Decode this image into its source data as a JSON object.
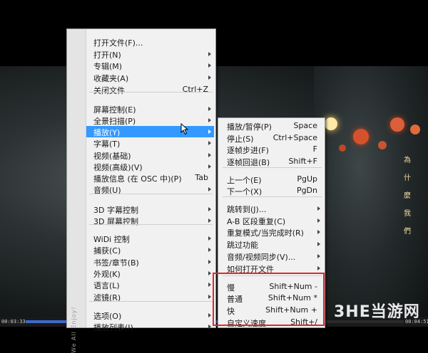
{
  "player": {
    "time_current": "00:03:33",
    "time_total": "00:04:51",
    "progress": 0.73,
    "lyric_chars": [
      "為",
      "什",
      "麼",
      "我",
      "們"
    ]
  },
  "watermark": {
    "text": "3HE当游网"
  },
  "context_menu": {
    "strip_text": "We All Enjoy!",
    "items": [
      {
        "label": "打开文件(F)...",
        "shortcut": "",
        "submenu": false
      },
      {
        "label": "打开(N)",
        "shortcut": "",
        "submenu": true
      },
      {
        "label": "专辑(M)",
        "shortcut": "",
        "submenu": true
      },
      {
        "label": "收藏夹(A)",
        "shortcut": "",
        "submenu": true
      },
      {
        "label": "关闭文件",
        "shortcut": "Ctrl+Z",
        "submenu": false
      },
      {
        "label": "屏幕控制(E)",
        "shortcut": "",
        "submenu": true
      },
      {
        "label": "全景扫描(P)",
        "shortcut": "",
        "submenu": true
      },
      {
        "label": "播放(Y)",
        "shortcut": "",
        "submenu": true,
        "highlighted": true
      },
      {
        "label": "字幕(T)",
        "shortcut": "",
        "submenu": true
      },
      {
        "label": "视频(基础)",
        "shortcut": "",
        "submenu": true
      },
      {
        "label": "视频(高级)(V)",
        "shortcut": "",
        "submenu": true
      },
      {
        "label": "播放信息 (在 OSC 中)(P)",
        "shortcut": "Tab",
        "submenu": false
      },
      {
        "label": "音频(U)",
        "shortcut": "",
        "submenu": true
      },
      {
        "label": "3D 字幕控制",
        "shortcut": "",
        "submenu": true
      },
      {
        "label": "3D 屏幕控制",
        "shortcut": "",
        "submenu": true
      },
      {
        "label": "WiDi 控制",
        "shortcut": "",
        "submenu": true
      },
      {
        "label": "捕获(C)",
        "shortcut": "",
        "submenu": true
      },
      {
        "label": "书签/章节(B)",
        "shortcut": "",
        "submenu": true
      },
      {
        "label": "外观(K)",
        "shortcut": "",
        "submenu": true
      },
      {
        "label": "语言(L)",
        "shortcut": "",
        "submenu": true
      },
      {
        "label": "滤镜(R)",
        "shortcut": "",
        "submenu": true
      },
      {
        "label": "选项(O)",
        "shortcut": "",
        "submenu": true
      },
      {
        "label": "播放列表(I)",
        "shortcut": "",
        "submenu": true
      }
    ]
  },
  "submenu": {
    "items": [
      {
        "label": "播放/暂停(P)",
        "shortcut": "Space",
        "submenu": false
      },
      {
        "label": "停止(S)",
        "shortcut": "Ctrl+Space",
        "submenu": false
      },
      {
        "label": "逐帧步进(F)",
        "shortcut": "F",
        "submenu": false
      },
      {
        "label": "逐帧回退(B)",
        "shortcut": "Shift+F",
        "submenu": false
      },
      {
        "label": "上一个(E)",
        "shortcut": "PgUp",
        "submenu": false
      },
      {
        "label": "下一个(X)",
        "shortcut": "PgDn",
        "submenu": false
      },
      {
        "label": "跳转到(J)...",
        "shortcut": "",
        "submenu": true
      },
      {
        "label": "A-B 区段重复(C)",
        "shortcut": "",
        "submenu": true
      },
      {
        "label": "重复模式/当完成时(R)",
        "shortcut": "",
        "submenu": true
      },
      {
        "label": "跳过功能",
        "shortcut": "",
        "submenu": true
      },
      {
        "label": "音频/视频同步(V)...",
        "shortcut": "",
        "submenu": true
      },
      {
        "label": "如何打开文件",
        "shortcut": "",
        "submenu": true
      },
      {
        "label": "慢",
        "shortcut": "Shift+Num -",
        "submenu": false
      },
      {
        "label": "普通",
        "shortcut": "Shift+Num *",
        "submenu": false
      },
      {
        "label": "快",
        "shortcut": "Shift+Num +",
        "submenu": false
      },
      {
        "label": "自定义速度",
        "shortcut": "Shift+/",
        "submenu": false
      }
    ]
  },
  "colors": {
    "highlight": "#3399ff",
    "annotation_box": "#e0282e",
    "progress": "#3e6ac8"
  }
}
